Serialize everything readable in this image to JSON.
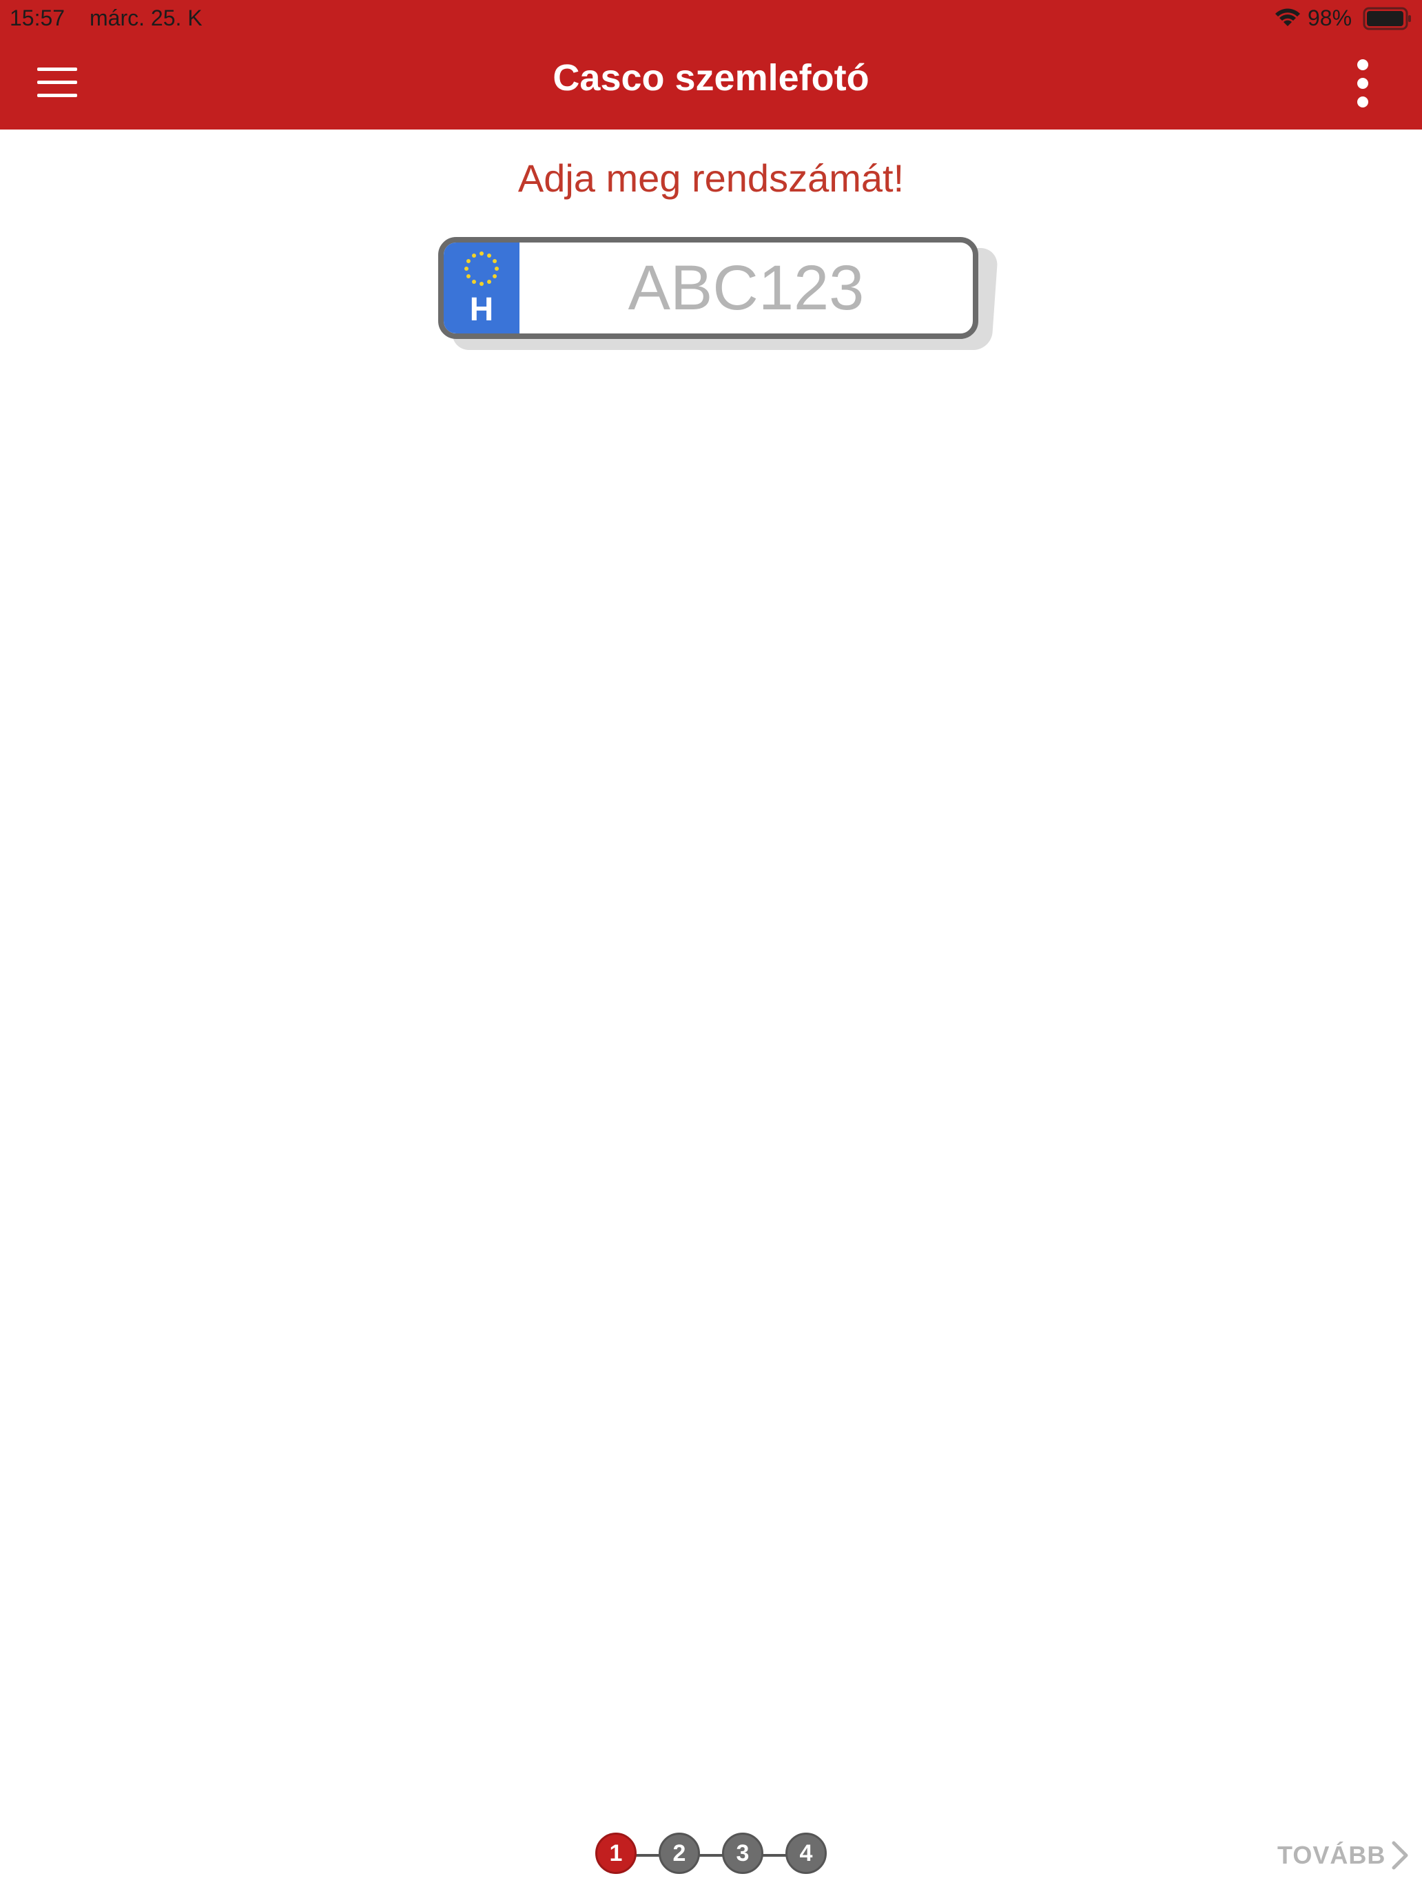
{
  "status_bar": {
    "time": "15:57",
    "date": "márc. 25. K",
    "battery_percent": "98%",
    "battery_level": 0.98,
    "icons": [
      "wifi-icon",
      "battery-icon"
    ]
  },
  "header": {
    "title": "Casco szemlefotó",
    "background_color": "#c21f1f",
    "menu_icon": "hamburger-icon",
    "more_icon": "more-vertical-icon"
  },
  "main": {
    "prompt": "Adja meg rendszámát!",
    "prompt_color": "#c0392b",
    "plate": {
      "country_code": "H",
      "eu_icon": "eu-stars-icon",
      "value": "",
      "placeholder": "ABC123",
      "band_color": "#3a74d8"
    }
  },
  "footer": {
    "steps": [
      {
        "label": "1",
        "active": true
      },
      {
        "label": "2",
        "active": false
      },
      {
        "label": "3",
        "active": false
      },
      {
        "label": "4",
        "active": false
      }
    ],
    "next_label": "TOVÁBB",
    "next_icon": "chevron-right-icon",
    "active_step_color": "#c21f1f",
    "inactive_step_color": "#6d6d6d"
  }
}
